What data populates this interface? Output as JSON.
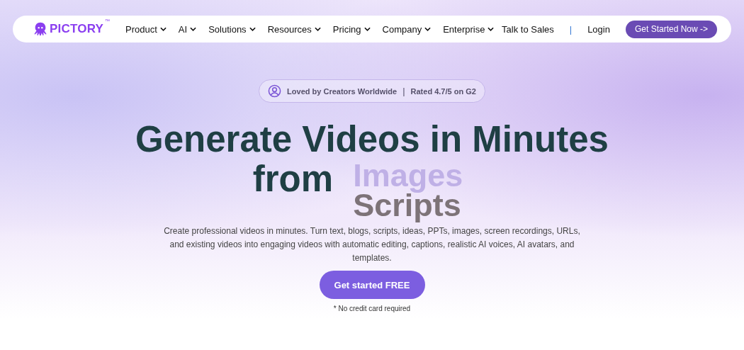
{
  "brand": {
    "name": "PICTORY",
    "mark": "™"
  },
  "nav": {
    "items": [
      {
        "label": "Product",
        "dropdown": true
      },
      {
        "label": "AI",
        "dropdown": true
      },
      {
        "label": "Solutions",
        "dropdown": true
      },
      {
        "label": "Resources",
        "dropdown": true
      },
      {
        "label": "Pricing",
        "dropdown": true
      },
      {
        "label": "Company",
        "dropdown": true
      },
      {
        "label": "Enterprise",
        "dropdown": true
      }
    ],
    "talk": "Talk to Sales",
    "separator": "|",
    "login": "Login",
    "cta": "Get Started Now ->"
  },
  "badge": {
    "text": "Loved by Creators Worldwide",
    "separator": "|",
    "rating": "Rated 4.7/5 on G2"
  },
  "hero": {
    "line1": "Generate Videos in Minutes",
    "line2": "from",
    "rotating_words": [
      "Images",
      "Scripts"
    ],
    "description": "Create professional videos in minutes. Turn text, blogs, scripts, ideas, PPTs, images, screen recordings, URLs, and existing videos into engaging videos with automatic editing, captions, realistic AI voices, AI avatars, and templates.",
    "cta": "Get started FREE",
    "note": "* No credit card required"
  }
}
